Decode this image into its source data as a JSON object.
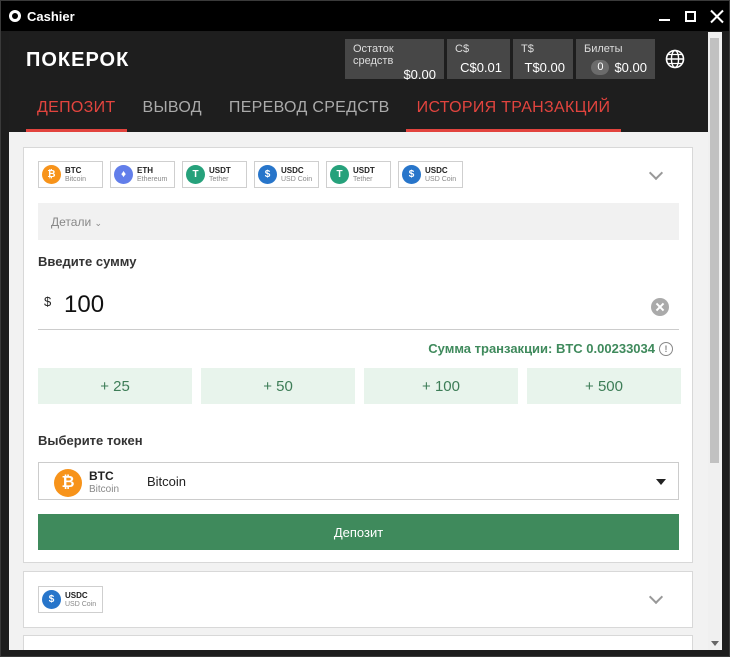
{
  "window": {
    "title": "Cashier"
  },
  "header": {
    "logo": "ПОКЕРОК",
    "balances": [
      {
        "label": "Остаток средств",
        "value": "$0.00"
      },
      {
        "label": "C$",
        "value": "C$0.01"
      },
      {
        "label": "T$",
        "value": "T$0.00"
      },
      {
        "label": "Билеты",
        "count": "0",
        "value": "$0.00"
      }
    ],
    "tabs": [
      "ДЕПОЗИТ",
      "ВЫВОД",
      "ПЕРЕВОД СРЕДСТВ",
      "ИСТОРИЯ ТРАНЗАКЦИЙ"
    ]
  },
  "tokens": [
    {
      "symbol": "BTC",
      "name": "Bitcoin",
      "color": "#f7931a",
      "glyph": "₿"
    },
    {
      "symbol": "ETH",
      "name": "Ethereum",
      "color": "#627eea",
      "glyph": "♦"
    },
    {
      "symbol": "USDT",
      "name": "Tether",
      "color": "#26a17b",
      "glyph": "T"
    },
    {
      "symbol": "USDC",
      "name": "USD Coin",
      "color": "#2775ca",
      "glyph": "$"
    },
    {
      "symbol": "USDT",
      "name": "Tether",
      "color": "#26a17b",
      "glyph": "T"
    },
    {
      "symbol": "USDC",
      "name": "USD Coin",
      "color": "#2775ca",
      "glyph": "$"
    }
  ],
  "deposit": {
    "details_label": "Детали",
    "amount_label": "Введите сумму",
    "currency_symbol": "$",
    "amount": "100",
    "tx_sum": "Сумма транзакции: BTC 0.00233034",
    "quick": [
      "+ 25",
      "+ 50",
      "+ 100",
      "+ 500"
    ],
    "token_label": "Выберите токен",
    "selected": {
      "symbol": "BTC",
      "sub": "Bitcoin",
      "name": "Bitcoin"
    },
    "button": "Депозит"
  },
  "second_card": {
    "symbol": "USDC",
    "name": "USD Coin",
    "color": "#2775ca"
  },
  "colors": {
    "accent_red": "#e2443e",
    "green": "#3f8a5c"
  }
}
